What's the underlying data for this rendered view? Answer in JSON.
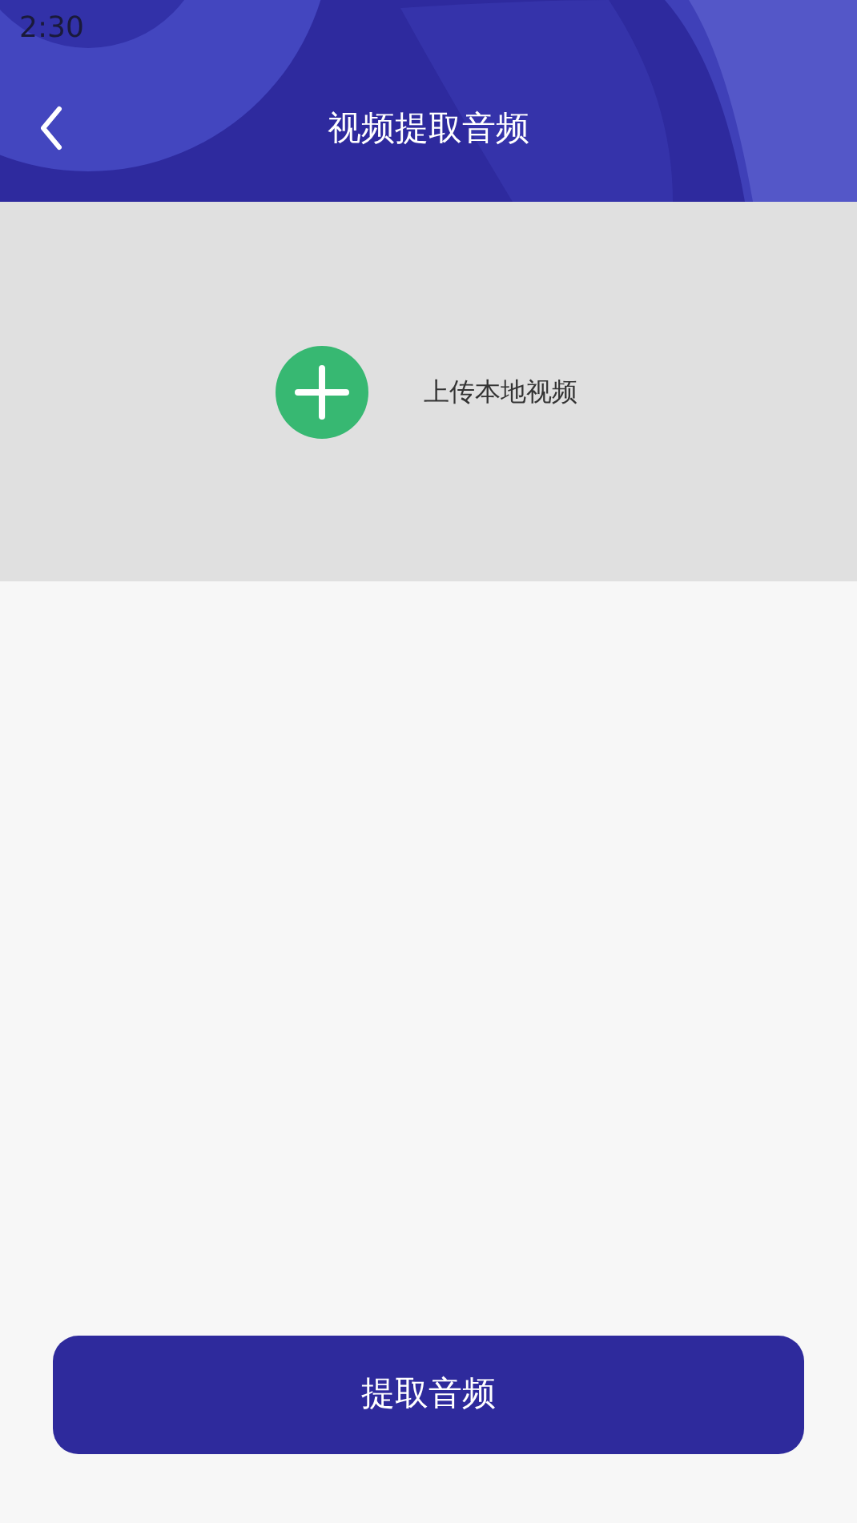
{
  "status_bar": {
    "time": "2:30"
  },
  "header": {
    "title": "视频提取音频"
  },
  "upload": {
    "label": "上传本地视频"
  },
  "action_button": {
    "label": "提取音频"
  }
}
